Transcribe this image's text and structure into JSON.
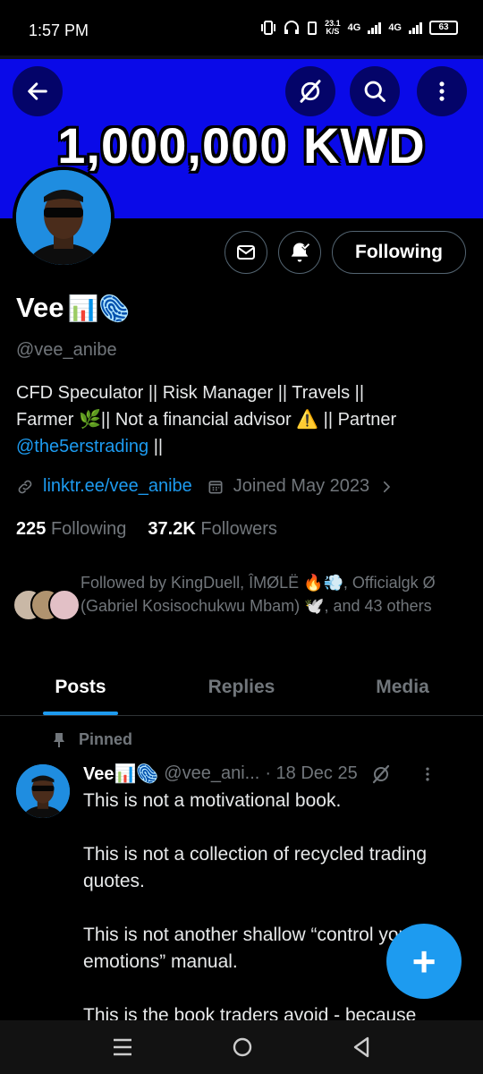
{
  "status_bar": {
    "time": "1:57 PM",
    "net_speed_value": "23.1",
    "net_speed_unit": "K/S",
    "network_1": "4G",
    "network_2": "4G",
    "battery": "63"
  },
  "banner": {
    "text": "1,000,000 KWD",
    "color": "#0a0ae8"
  },
  "header_icons": {
    "back": "back-arrow-icon",
    "grok": "grok-icon",
    "search": "search-icon",
    "more": "more-vertical-icon"
  },
  "profile": {
    "display_name": "Vee",
    "name_emojis": "📊🫆",
    "handle": "@vee_anibe",
    "bio_line1": "CFD Speculator || Risk Manager  || Travels ||",
    "bio_line2": "Farmer 🌿|| Not a financial advisor ⚠️ || Partner",
    "bio_mention": "@the5erstrading",
    "bio_suffix": " ||",
    "link": "linktr.ee/vee_anibe",
    "joined": "Joined May 2023",
    "following_count": "225",
    "following_label": "Following",
    "followers_count": "37.2K",
    "followers_label": "Followers",
    "followed_by": "Followed by KingDuell, ÎMØLË 🔥💨, Officialgk Ø (Gabriel Kosisochukwu Mbam) 🕊️, and 43 others"
  },
  "actions": {
    "following_button": "Following",
    "message_icon": "envelope-icon",
    "notify_icon": "bell-check-icon"
  },
  "tabs": [
    {
      "label": "Posts",
      "active": true
    },
    {
      "label": "Replies",
      "active": false
    },
    {
      "label": "Media",
      "active": false
    }
  ],
  "pinned_post": {
    "pinned_label": "Pinned",
    "name": "Vee📊🫆",
    "handle": "@vee_ani...",
    "date": "· 18 Dec 25",
    "paragraphs": [
      "This is not a motivational book.",
      "This is not a collection of recycled trading quotes.",
      "This is not another shallow “control your emotions” manual.",
      "This is the book traders avoid - because"
    ]
  },
  "fab": {
    "label": "+"
  },
  "accent_color": "#1d9bf0"
}
